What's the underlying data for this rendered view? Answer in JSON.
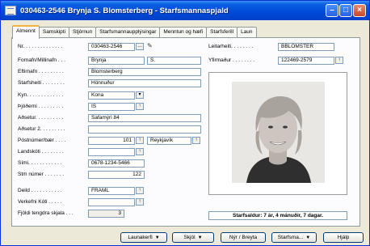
{
  "window": {
    "title": "030463-2546 Brynja S. Blomsterberg - Starfsmannaspjald"
  },
  "tabs": [
    "Almennt",
    "Samskipti",
    "Stjórnun",
    "Starfsmannaupplýsingar",
    "Menntun og hæfi",
    "Starfsferill",
    "Laun"
  ],
  "left_labels": {
    "nr": "Nr. . . . . . . . . . . . . .",
    "fornafn": "Fornafn/Millinafn . . .",
    "eftirnafn": "Eftirnafn . . . . . . . . .",
    "starfsheiti": "Starfsheiti . . . . . . . .",
    "kyn": "Kyn. . . . . . . . . . . . .",
    "thjoderni": "Þjóðerni . . . . . . . . .",
    "adsetur": "Aðsetur. . . . . . . . . .",
    "adsetur2": "Aðsetur 2. . . . . . . . .",
    "postnumer": "Póstnúmer/bær . . . .",
    "landskodi": "Landskóti . . . . . . . .",
    "simi": "Sími. . . . . . . . . . . .",
    "stm": "Stm númer . . . . . . .",
    "deild": "Deild . . . . . . . . . . .",
    "verkefni": "Verkefni Kóti . . . . .",
    "fjoldi": "Fjöldi tengdra skjala . . ."
  },
  "left_values": {
    "nr": "030463-2546",
    "fornafn": "Brynja",
    "millinafn": "S.",
    "eftirnafn": "Blomsterberg",
    "starfsheiti": "Hönnuður",
    "kyn": "Kona",
    "thjoderni": "IS",
    "adsetur": "Safamýri 84",
    "adsetur2": "",
    "postnumer": "101",
    "baer": "Reykjavík",
    "landskodi": "",
    "simi": "0678-1234-5466",
    "stm": "122",
    "deild": "FRAML",
    "verkefni": "",
    "fjoldi": "3"
  },
  "right_labels": {
    "leitarheiti": "Leitarheiti. . . . . . . .",
    "yfirmadur": "Yfirmaður . . . . . . . ."
  },
  "right_values": {
    "leitarheiti": "BBLOMSTER",
    "yfirmadur": "122469-2579"
  },
  "seniority": "Starfsaldur: 7 ár, 4 mánuðir, 7 dagar.",
  "buttons": {
    "launakerfi": "Launakerfi",
    "skjol": "Skjöl",
    "ny_breyta": "Nýr / Breyta",
    "starfsmadur": "Starfsma...",
    "hjalp": "Hjálp"
  },
  "colors": {
    "title_bar": "#0a5fe0",
    "tab_highlight": "#f1b33a",
    "window_bg": "#ece9d8"
  }
}
